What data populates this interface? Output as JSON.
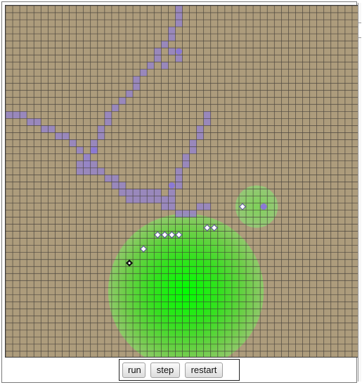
{
  "colors": {
    "soil": "#ad9c7c",
    "grid_line": "#3d3a35",
    "pheromone_trail": "#9585c8",
    "food_core": "#00ff00",
    "food_outer": "#8fc96a",
    "ant_fill": "#ffffff",
    "ant_outline": "#5a4f9a",
    "carrying_ant": "#222222"
  },
  "simulation": {
    "grid_columns": 50,
    "grid_rows": 50,
    "food_sources": [
      {
        "col": 25,
        "row": 40,
        "radius_cells": 11
      },
      {
        "col": 35,
        "row": 28,
        "radius_cells": 3
      }
    ],
    "trail_cells": [
      [
        24,
        0
      ],
      [
        24,
        1
      ],
      [
        24,
        2
      ],
      [
        23,
        3
      ],
      [
        23,
        4
      ],
      [
        22,
        5
      ],
      [
        21,
        6
      ],
      [
        21,
        7
      ],
      [
        20,
        8
      ],
      [
        19,
        9
      ],
      [
        18,
        10
      ],
      [
        18,
        11
      ],
      [
        17,
        12
      ],
      [
        16,
        13
      ],
      [
        15,
        14
      ],
      [
        14,
        15
      ],
      [
        14,
        16
      ],
      [
        13,
        17
      ],
      [
        13,
        18
      ],
      [
        12,
        19
      ],
      [
        12,
        20
      ],
      [
        11,
        21
      ],
      [
        11,
        22
      ],
      [
        10,
        23
      ],
      [
        0,
        15
      ],
      [
        1,
        15
      ],
      [
        2,
        15
      ],
      [
        3,
        16
      ],
      [
        4,
        16
      ],
      [
        5,
        17
      ],
      [
        6,
        17
      ],
      [
        7,
        18
      ],
      [
        8,
        18
      ],
      [
        9,
        19
      ],
      [
        10,
        20
      ],
      [
        11,
        21
      ],
      [
        10,
        22
      ],
      [
        11,
        22
      ],
      [
        12,
        22
      ],
      [
        12,
        23
      ],
      [
        11,
        23
      ],
      [
        13,
        23
      ],
      [
        14,
        24
      ],
      [
        15,
        24
      ],
      [
        16,
        25
      ],
      [
        17,
        26
      ],
      [
        18,
        26
      ],
      [
        19,
        27
      ],
      [
        20,
        27
      ],
      [
        21,
        27
      ],
      [
        22,
        28
      ],
      [
        23,
        28
      ],
      [
        24,
        29
      ],
      [
        25,
        29
      ],
      [
        26,
        29
      ],
      [
        27,
        28
      ],
      [
        28,
        28
      ],
      [
        28,
        15
      ],
      [
        28,
        16
      ],
      [
        27,
        17
      ],
      [
        27,
        18
      ],
      [
        26,
        19
      ],
      [
        26,
        20
      ],
      [
        25,
        21
      ],
      [
        25,
        22
      ],
      [
        24,
        23
      ],
      [
        24,
        24
      ],
      [
        24,
        25
      ],
      [
        23,
        26
      ],
      [
        23,
        27
      ],
      [
        15,
        25
      ],
      [
        16,
        26
      ],
      [
        17,
        27
      ],
      [
        18,
        27
      ],
      [
        19,
        26
      ],
      [
        20,
        26
      ],
      [
        21,
        26
      ],
      [
        22,
        27
      ],
      [
        24,
        7
      ],
      [
        23,
        6
      ],
      [
        22,
        8
      ],
      [
        12,
        20
      ]
    ],
    "trail_dots": [
      {
        "col": 24,
        "row": 6
      },
      {
        "col": 12,
        "row": 20
      },
      {
        "col": 23,
        "row": 25
      },
      {
        "col": 36,
        "row": 28
      }
    ],
    "ants": [
      {
        "col": 33,
        "row": 28,
        "carrying": false
      },
      {
        "col": 28,
        "row": 31,
        "carrying": false
      },
      {
        "col": 29,
        "row": 31,
        "carrying": false
      },
      {
        "col": 24,
        "row": 32,
        "carrying": false
      },
      {
        "col": 23,
        "row": 32,
        "carrying": false
      },
      {
        "col": 22,
        "row": 32,
        "carrying": false
      },
      {
        "col": 21,
        "row": 32,
        "carrying": false
      },
      {
        "col": 19,
        "row": 34,
        "carrying": false
      },
      {
        "col": 17,
        "row": 36,
        "carrying": true
      }
    ]
  },
  "controls": {
    "run_label": "run",
    "step_label": "step",
    "restart_label": "restart"
  }
}
